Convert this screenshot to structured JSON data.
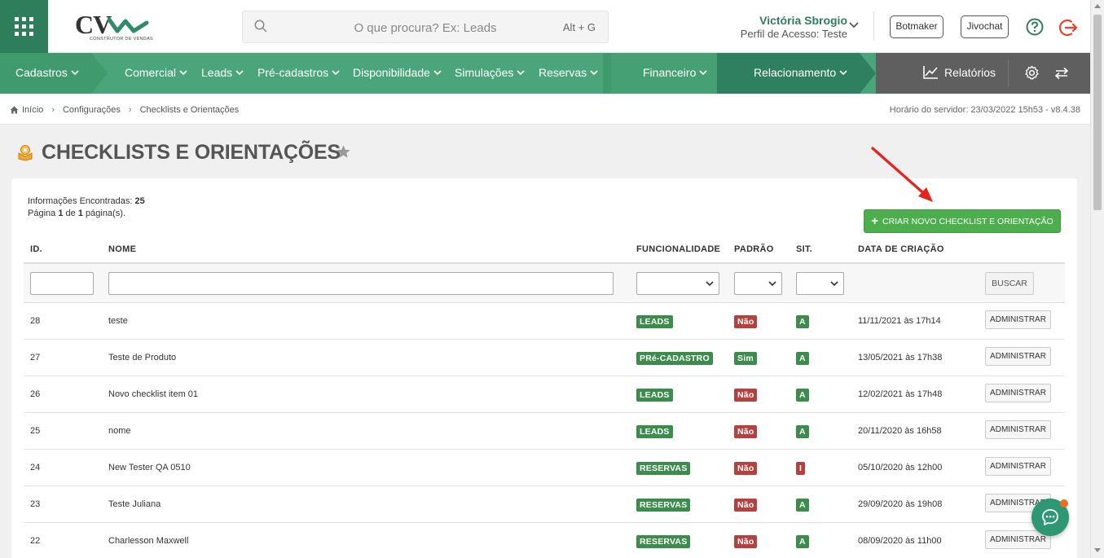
{
  "header": {
    "logo_text": "CV",
    "logo_subtitle": "CONSTRUTOR DE VENDAS",
    "search_placeholder": "O que procura? Ex: Leads",
    "search_shortcut": "Alt + G",
    "user_name": "Victória Sbrogio",
    "user_profile": "Perfil de Acesso: Teste",
    "botmaker_label": "Botmaker",
    "jivochat_label": "Jivochat"
  },
  "nav": {
    "items": [
      {
        "label": "Cadastros"
      },
      {
        "label": "Comercial"
      },
      {
        "label": "Leads"
      },
      {
        "label": "Pré-cadastros"
      },
      {
        "label": "Disponibilidade"
      },
      {
        "label": "Simulações"
      },
      {
        "label": "Reservas"
      },
      {
        "label": "Financeiro"
      },
      {
        "label": "Relacionamento"
      }
    ],
    "reports_label": "Relatórios"
  },
  "breadcrumb": {
    "items": [
      "Início",
      "Configurações",
      "Checklists e Orientações"
    ],
    "server_time": "Horário do servidor: 23/03/2022 15h53 - v8.4.38"
  },
  "page": {
    "title": "CHECKLISTS E ORIENTAÇÕES",
    "info_found_label": "Informações Encontradas:",
    "info_found_count": "25",
    "info_page_word": "Página",
    "info_page_current": "1",
    "info_of_word": "de",
    "info_page_total": "1",
    "info_pages_suffix": "página(s).",
    "create_button": "CRIAR NOVO CHECKLIST E ORIENTAÇÃO",
    "search_button": "BUSCAR",
    "admin_button": "ADMINISTRAR"
  },
  "table": {
    "headers": [
      "ID.",
      "NOME",
      "FUNCIONALIDADE",
      "PADRÃO",
      "SIT.",
      "DATA DE CRIAÇÃO"
    ],
    "rows": [
      {
        "id": "28",
        "name": "teste",
        "func": "LEADS",
        "padrao": "Não",
        "sit": "A",
        "date": "11/11/2021 às 17h14"
      },
      {
        "id": "27",
        "name": "Teste de Produto",
        "func": "PRé-CADASTRO",
        "padrao": "Sim",
        "sit": "A",
        "date": "13/05/2021 às 17h38"
      },
      {
        "id": "26",
        "name": "Novo checklist item 01",
        "func": "LEADS",
        "padrao": "Não",
        "sit": "A",
        "date": "12/02/2021 às 17h48"
      },
      {
        "id": "25",
        "name": "nome",
        "func": "LEADS",
        "padrao": "Não",
        "sit": "A",
        "date": "20/11/2020 às 16h58"
      },
      {
        "id": "24",
        "name": "New Tester QA 0510",
        "func": "RESERVAS",
        "padrao": "Não",
        "sit": "I",
        "date": "05/10/2020 às 12h00"
      },
      {
        "id": "23",
        "name": "Teste Juliana",
        "func": "RESERVAS",
        "padrao": "Não",
        "sit": "A",
        "date": "29/09/2020 às 19h08"
      },
      {
        "id": "22",
        "name": "Charlesson Maxwell",
        "func": "RESERVAS",
        "padrao": "Não",
        "sit": "A",
        "date": "08/09/2020 às 11h00"
      }
    ]
  },
  "colors": {
    "brand_dark": "#2e7d5b",
    "nav_green": "#4aa67a",
    "badge_green": "#3c8c4c",
    "badge_red": "#b5413e",
    "create_green": "#4cae4c",
    "arrow_red": "#e8201e",
    "chat_dot": "#f36b21"
  }
}
